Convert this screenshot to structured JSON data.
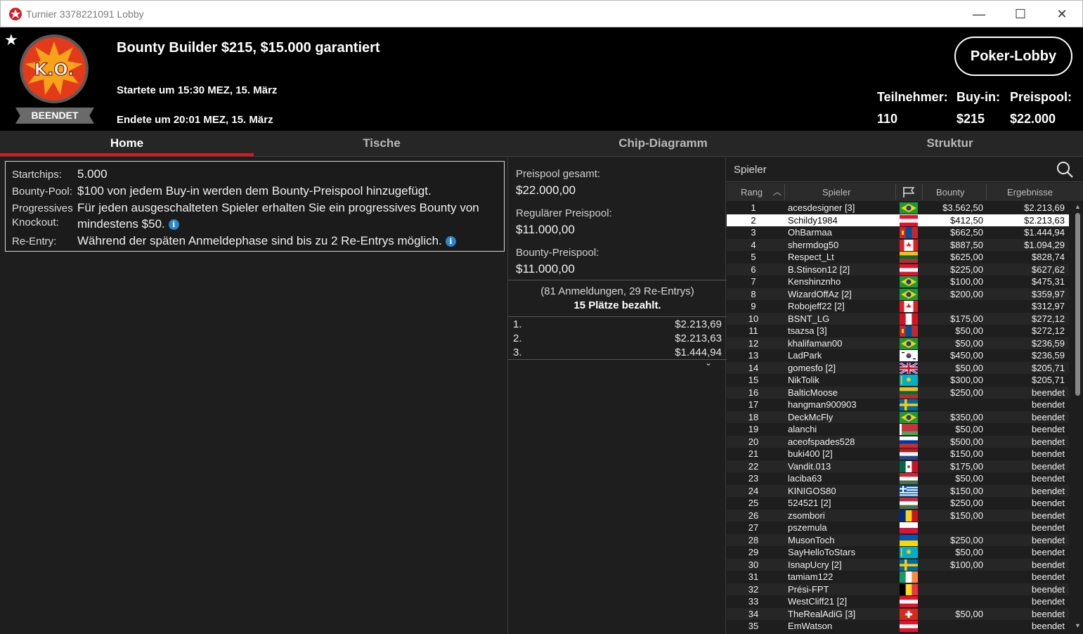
{
  "window": {
    "title": "Turnier 3378221091 Lobby",
    "minimize": "—",
    "maximize": "☐",
    "close": "✕"
  },
  "header": {
    "tournament_name": "Bounty Builder $215, $15.000 garantiert",
    "started": "Startete um 15:30 MEZ, 15. März",
    "ended": "Endete um 20:01 MEZ, 15. März",
    "status": "BEENDET",
    "badge_text": "K.O.",
    "lobby_button": "Poker-Lobby",
    "stats": [
      {
        "label": "Teilnehmer:",
        "value": "110"
      },
      {
        "label": "Buy-in:",
        "value": "$215"
      },
      {
        "label": "Preispool:",
        "value": "$22.000"
      }
    ]
  },
  "tabs": [
    {
      "label": "Home",
      "active": true
    },
    {
      "label": "Tische",
      "active": false
    },
    {
      "label": "Chip-Diagramm",
      "active": false
    },
    {
      "label": "Struktur",
      "active": false
    }
  ],
  "info": {
    "startchips_label": "Startchips:",
    "startchips_value": "5.000",
    "bountypool_label": "Bounty-Pool:",
    "bountypool_value": "$100 von jedem Buy-in werden dem Bounty-Preispool hinzugefügt.",
    "progressive_label_1": "Progressives",
    "progressive_label_2": "Knockout:",
    "progressive_value_1": "Für jeden ausgeschalteten Spieler erhalten Sie ein progressives Bounty von",
    "progressive_value_2": "mindestens $50.",
    "reentry_label": "Re-Entry:",
    "reentry_value": "Während der späten Anmeldephase sind bis zu 2 Re-Entrys möglich."
  },
  "prizepool": {
    "total_label": "Preispool gesamt:",
    "total_value": "$22.000,00",
    "regular_label": "Regulärer Preispool:",
    "regular_value": "$11.000,00",
    "bounty_label": "Bounty-Preispool:",
    "bounty_value": "$11.000,00",
    "registrations": "(81 Anmeldungen, 29 Re-Entrys)",
    "paid_places": "15 Plätze bezahlt.",
    "payouts": [
      {
        "place": "1.",
        "amount": "$2.213,69"
      },
      {
        "place": "2.",
        "amount": "$2.213,63"
      },
      {
        "place": "3.",
        "amount": "$1.444,94"
      }
    ]
  },
  "players_panel": {
    "search_label": "Spieler",
    "col_rank": "Rang",
    "col_player": "Spieler",
    "col_bounty": "Bounty",
    "col_result": "Ergebnisse",
    "selected_rank": 2,
    "rows": [
      {
        "rank": "1",
        "name": "acesdesigner [3]",
        "flag": "BR",
        "bounty": "$3.562,50",
        "result": "$2.213,69"
      },
      {
        "rank": "2",
        "name": "Schildy1984",
        "flag": "AT",
        "bounty": "$412,50",
        "result": "$2.213,63"
      },
      {
        "rank": "3",
        "name": "OhBarmaa",
        "flag": "MN",
        "bounty": "$662,50",
        "result": "$1.444,94"
      },
      {
        "rank": "4",
        "name": "shermdog50",
        "flag": "CA",
        "bounty": "$887,50",
        "result": "$1.094,29"
      },
      {
        "rank": "5",
        "name": "Respect_Lt",
        "flag": "LT",
        "bounty": "$625,00",
        "result": "$828,74"
      },
      {
        "rank": "6",
        "name": "B.Stinson12 [2]",
        "flag": "AT",
        "bounty": "$225,00",
        "result": "$627,62"
      },
      {
        "rank": "7",
        "name": "Kenshinznho",
        "flag": "BR",
        "bounty": "$100,00",
        "result": "$475,31"
      },
      {
        "rank": "8",
        "name": "WizardOffAz [2]",
        "flag": "BR",
        "bounty": "$200,00",
        "result": "$359,97"
      },
      {
        "rank": "9",
        "name": "Robojeff22 [2]",
        "flag": "CA",
        "bounty": "",
        "result": "$312,97"
      },
      {
        "rank": "10",
        "name": "BSNT_LG",
        "flag": "PE",
        "bounty": "$175,00",
        "result": "$272,12"
      },
      {
        "rank": "11",
        "name": "tsazsa [3]",
        "flag": "MN",
        "bounty": "$50,00",
        "result": "$272,12"
      },
      {
        "rank": "12",
        "name": "khalifaman00",
        "flag": "BR",
        "bounty": "$50,00",
        "result": "$236,59"
      },
      {
        "rank": "13",
        "name": "LadPark",
        "flag": "KR",
        "bounty": "$450,00",
        "result": "$236,59"
      },
      {
        "rank": "14",
        "name": "gomesfo [2]",
        "flag": "GB",
        "bounty": "$50,00",
        "result": "$205,71"
      },
      {
        "rank": "15",
        "name": "NikTolik",
        "flag": "KZ",
        "bounty": "$300,00",
        "result": "$205,71"
      },
      {
        "rank": "16",
        "name": "BalticMoose",
        "flag": "LT",
        "bounty": "$250,00",
        "result": "beendet"
      },
      {
        "rank": "17",
        "name": "hangman900903",
        "flag": "SE",
        "bounty": "",
        "result": "beendet"
      },
      {
        "rank": "18",
        "name": "DeckMcFly",
        "flag": "BR",
        "bounty": "$350,00",
        "result": "beendet"
      },
      {
        "rank": "19",
        "name": "alanchi",
        "flag": "BY",
        "bounty": "$50,00",
        "result": "beendet"
      },
      {
        "rank": "20",
        "name": "aceofspades528",
        "flag": "RU",
        "bounty": "$500,00",
        "result": "beendet"
      },
      {
        "rank": "21",
        "name": "buki400 [2]",
        "flag": "NL",
        "bounty": "$150,00",
        "result": "beendet"
      },
      {
        "rank": "22",
        "name": "Vandit.013",
        "flag": "MX",
        "bounty": "$175,00",
        "result": "beendet"
      },
      {
        "rank": "23",
        "name": "laciba63",
        "flag": "HU",
        "bounty": "$50,00",
        "result": "beendet"
      },
      {
        "rank": "24",
        "name": "KINIGOS80",
        "flag": "GR",
        "bounty": "$150,00",
        "result": "beendet"
      },
      {
        "rank": "25",
        "name": "524521 [2]",
        "flag": "HU",
        "bounty": "$250,00",
        "result": "beendet"
      },
      {
        "rank": "26",
        "name": "zsombori",
        "flag": "RO",
        "bounty": "$150,00",
        "result": "beendet"
      },
      {
        "rank": "27",
        "name": "pszemula",
        "flag": "PL",
        "bounty": "",
        "result": "beendet"
      },
      {
        "rank": "28",
        "name": "MusonToch",
        "flag": "UA",
        "bounty": "$250,00",
        "result": "beendet"
      },
      {
        "rank": "29",
        "name": "SayHelloToStars",
        "flag": "KZ",
        "bounty": "$50,00",
        "result": "beendet"
      },
      {
        "rank": "30",
        "name": "IsnapUcry [2]",
        "flag": "SE",
        "bounty": "$100,00",
        "result": "beendet"
      },
      {
        "rank": "31",
        "name": "tamiam122",
        "flag": "IE",
        "bounty": "",
        "result": "beendet"
      },
      {
        "rank": "32",
        "name": "Prési-FPT",
        "flag": "BE",
        "bounty": "",
        "result": "beendet"
      },
      {
        "rank": "33",
        "name": "WestCliff21 [2]",
        "flag": "AT",
        "bounty": "",
        "result": "beendet"
      },
      {
        "rank": "34",
        "name": "TheRealAdiG [3]",
        "flag": "CH",
        "bounty": "$50,00",
        "result": "beendet"
      },
      {
        "rank": "35",
        "name": "EmWatson",
        "flag": "AT",
        "bounty": "",
        "result": "beendet"
      }
    ]
  }
}
